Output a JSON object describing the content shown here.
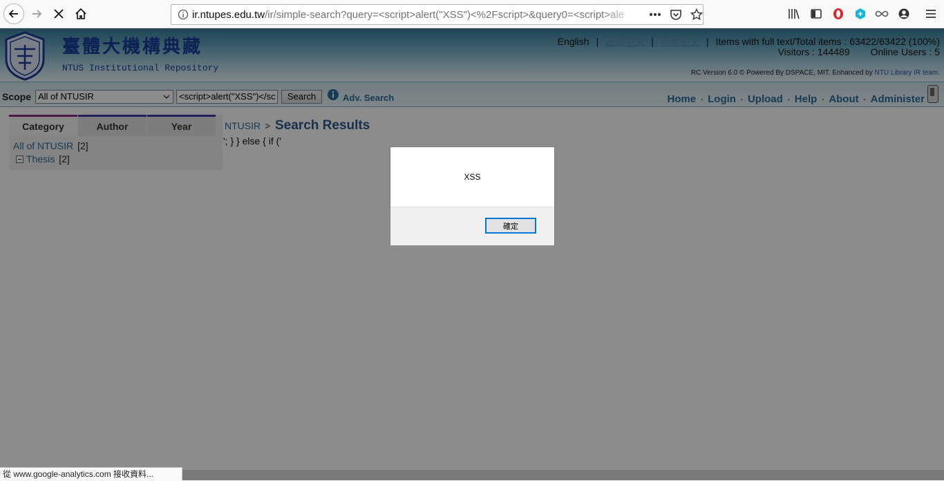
{
  "browser": {
    "url_host": "ir.ntupes.edu.tw",
    "url_path": "/ir/simple-search?query=<script>alert(\"XSS\")<%2Fscript>&query0=<script>ale"
  },
  "header": {
    "title_zh": "臺體大機構典藏",
    "title_en": "NTUS Institutional Repository",
    "lang_english": "English",
    "lang_traditional": "正體中文",
    "lang_simplified": "简体中文",
    "items_text": "Items with full text/Total items : 63422/63422 (100%)",
    "visitors_text": "Visitors : 144489",
    "online_text": "Online Users : 5",
    "version_text": "RC Version 6.0 © Powered By DSPACE, MIT. Enhanced by",
    "version_link": "NTU Library IR team."
  },
  "search": {
    "scope_label": "Scope",
    "scope_value": "All of NTUSIR",
    "query_value": "<script>alert(\"XSS\")</sc",
    "button_label": "Search",
    "adv_label": "Adv. Search"
  },
  "nav": {
    "items": [
      "Home",
      "Login",
      "Upload",
      "Help",
      "About",
      "Administer"
    ]
  },
  "facets": {
    "tabs": [
      "Category",
      "Author",
      "Year"
    ],
    "all_label": "All of NTUSIR",
    "all_count": "[2]",
    "thesis_label": "Thesis",
    "thesis_count": "[2]"
  },
  "results": {
    "breadcrumb_root": "NTUSIR",
    "breadcrumb_sep": ">",
    "title": "Search Results",
    "leaked_script": "'; } } else { if ('"
  },
  "dialog": {
    "message": "XSS",
    "ok_label": "確定"
  },
  "status": {
    "text": "從 www.google-analytics.com 接收資料..."
  },
  "colors": {
    "link": "#2b6c9c",
    "accent_focus": "#0078d7"
  }
}
